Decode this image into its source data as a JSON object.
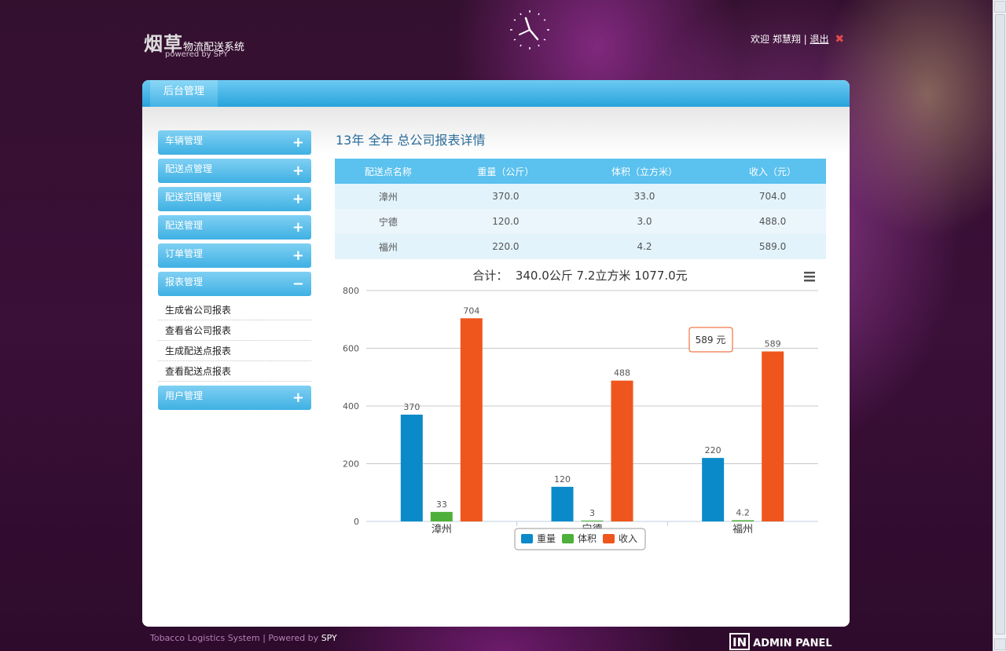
{
  "header": {
    "logo_big": "烟草",
    "logo_small": "物流配送系统",
    "logo_powered": "powered by SPY",
    "welcome": "欢迎 郑慧翔 |",
    "logout": "退出"
  },
  "panel": {
    "tab": "后台管理"
  },
  "sidebar": {
    "items": [
      {
        "label": "车辆管理",
        "sign": "+"
      },
      {
        "label": "配送点管理",
        "sign": "+"
      },
      {
        "label": "配送范围管理",
        "sign": "+"
      },
      {
        "label": "配送管理",
        "sign": "+"
      },
      {
        "label": "订单管理",
        "sign": "+"
      },
      {
        "label": "报表管理",
        "sign": "−"
      }
    ],
    "subitems": [
      "生成省公司报表",
      "查看省公司报表",
      "生成配送点报表",
      "查看配送点报表"
    ],
    "last_item": {
      "label": "用户管理",
      "sign": "+"
    }
  },
  "main": {
    "title": "13年 全年 总公司报表详情",
    "table": {
      "headers": [
        "配送点名称",
        "重量（公斤）",
        "体积（立方米）",
        "收入（元）"
      ],
      "rows": [
        [
          "漳州",
          "370.0",
          "33.0",
          "704.0"
        ],
        [
          "宁德",
          "120.0",
          "3.0",
          "488.0"
        ],
        [
          "福州",
          "220.0",
          "4.2",
          "589.0"
        ]
      ]
    }
  },
  "chart_data": {
    "type": "bar",
    "title": "合计：  340.0公斤 7.2立方米 1077.0元",
    "categories": [
      "漳州",
      "宁德",
      "福州"
    ],
    "series": [
      {
        "name": "重量",
        "values": [
          370,
          120,
          220
        ],
        "labels": [
          "370",
          "120",
          "220"
        ],
        "color": "#0b8ac9"
      },
      {
        "name": "体积",
        "values": [
          33,
          3,
          4.2
        ],
        "labels": [
          "33",
          "3",
          "4.2"
        ],
        "color": "#4eb03a"
      },
      {
        "name": "收入",
        "values": [
          704,
          488,
          589
        ],
        "labels": [
          "704",
          "488",
          "589"
        ],
        "color": "#ef561d"
      }
    ],
    "ylim": [
      0,
      800
    ],
    "yticks": [
      "0",
      "200",
      "400",
      "600",
      "800"
    ],
    "grid": true,
    "legend": "bottom-center",
    "tooltip": "589 元"
  },
  "footer": {
    "text": "Tobacco Logistics System | Powered by ",
    "spy": "SPY",
    "admin_box": "IN",
    "admin_text": "ADMIN PANEL"
  }
}
